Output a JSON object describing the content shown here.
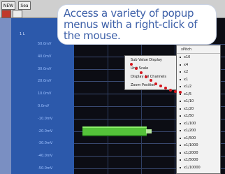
{
  "toolbar": {
    "new_label": "NEW",
    "second_label": "Sea"
  },
  "axis": {
    "header": "1 L",
    "ticks": [
      "50.0mV",
      "40.0mV",
      "30.0mV",
      "20.0mV",
      "10.0mV",
      "0.0mV",
      "-10.0mV",
      "-20.0mV",
      "-30.0mV",
      "-40.0mV",
      "-50.0mV"
    ]
  },
  "context_menu": {
    "items": [
      "Sub Value Display",
      "Unit Scale",
      "Display All Channels",
      "Zoom Position"
    ]
  },
  "zoom_menu": {
    "header": "xPitch",
    "items": [
      "x10",
      "x4",
      "x2",
      "x1",
      "x1/2",
      "x1/5",
      "x1/10",
      "x1/20",
      "x1/50",
      "x1/100",
      "x1/200",
      "x1/500",
      "x1/1000",
      "x1/2000",
      "x1/5000",
      "x1/10000"
    ]
  },
  "callout": {
    "text": "Access a variety of popup menus with a right-click of the mouse."
  },
  "colors": {
    "accent": "#3c5fa8",
    "wave": "#54c23a",
    "pointer_dots": "#d4161e"
  }
}
